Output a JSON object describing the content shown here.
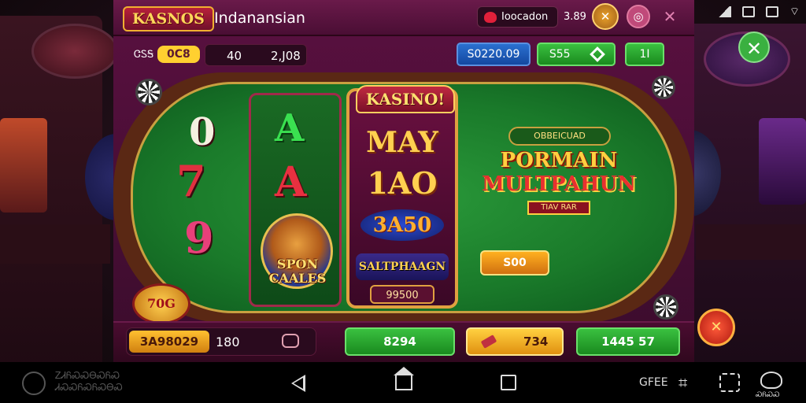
{
  "status_bar": {
    "icons": [
      "signal-icon",
      "battery-icon",
      "notification-icon",
      "wifi-icon"
    ]
  },
  "header": {
    "logo": "KASNOS",
    "title": "Indanansian",
    "pill_label": "Ioocadon",
    "value": "3.89",
    "gold_button": "✕",
    "pink_button": "◎",
    "x_button": "✕"
  },
  "subbar": {
    "tag": "ᏣᏚᎦ",
    "yellow_pill": "0C8",
    "value1": "40",
    "value2": "2,J08",
    "blue_button": "S0220.09",
    "green_button": "S55",
    "small_green_button": "1I"
  },
  "table": {
    "left_symbols": [
      "0",
      "7",
      "9"
    ],
    "reel1": {
      "symbol_a_top": "A",
      "symbol_a_bottom": "A",
      "spin_label": "SPON CAALES"
    },
    "reel2": {
      "header": "KASINO!",
      "line1": "MAY",
      "line2": "1AO",
      "line3": "3A50",
      "line4": "SALTPHAAGN",
      "line5": "99500"
    },
    "promo": {
      "banner": "OBBEICUAD",
      "line1": "PORMAIN",
      "line2": "MULTPAHUN",
      "line3": "TIAV RAR",
      "button": "S00"
    },
    "badge": "70G"
  },
  "bottom_bar": {
    "balance_gold": "3A98029",
    "balance_num": "180",
    "green1": "8294",
    "gold_button": "734",
    "green2": "1445 57"
  },
  "side_controls": {
    "close": "✕",
    "red_button": "✕"
  },
  "nav_bar": {
    "left_text_line1": "ᏃᏗᏲᏍᏍᎾᏍᏲᏍ",
    "left_text_line2": "ᏗᏍᏍᏲᏍᏲᏍᎾᏍ",
    "right_text": "GFEE",
    "right_icon_label": "ᏍᏲᏍᏍ"
  }
}
